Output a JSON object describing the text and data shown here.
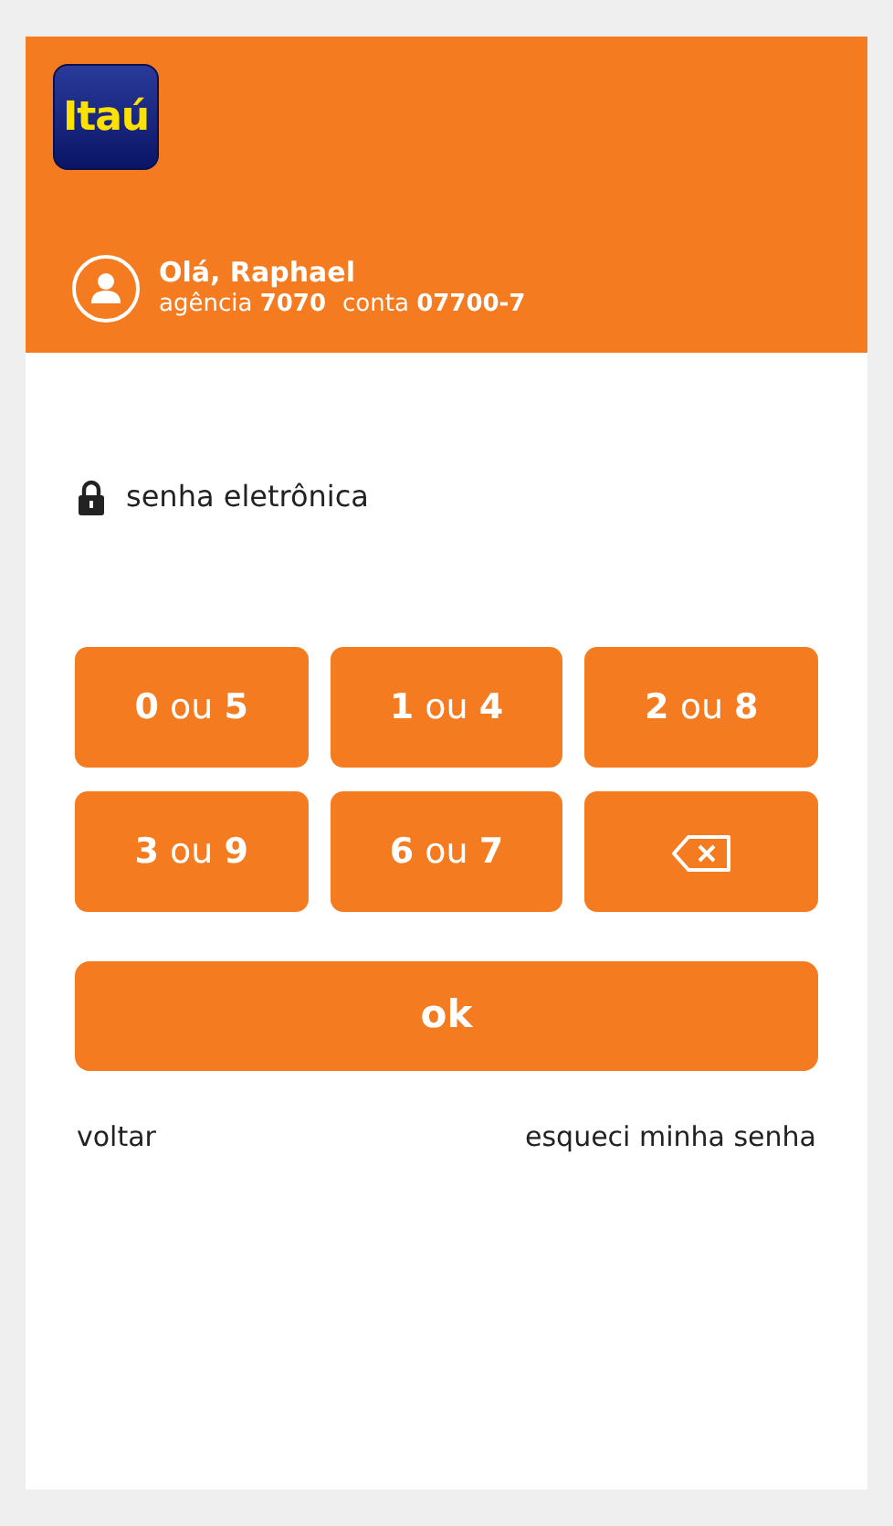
{
  "header": {
    "logo": "Itaú",
    "greeting": "Olá, Raphael",
    "agency": "agência **7070**",
    "account": "conta **07700-7**"
  },
  "password": {
    "label": "senha eletrônica"
  },
  "keys": [
    {
      "kind": "digits",
      "label": "**0** ou **5**"
    },
    {
      "kind": "digits",
      "label": "**1** ou **4**"
    },
    {
      "kind": "digits",
      "label": "**2** ou **8**"
    },
    {
      "kind": "digits",
      "label": "**3** ou **9**"
    },
    {
      "kind": "digits",
      "label": "**6** ou **7**"
    },
    {
      "kind": "backspace"
    }
  ],
  "ok_button": "ok",
  "links": {
    "back": "voltar",
    "forgot": "esqueci minha senha"
  }
}
